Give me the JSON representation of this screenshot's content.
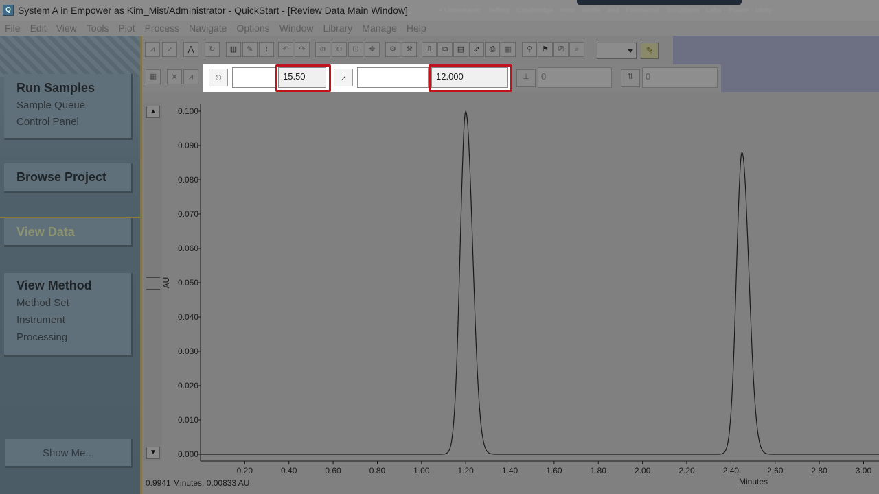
{
  "window": {
    "title": "System A in Empower as Kim_Mist/Administrator - QuickStart - [Review Data Main Window]",
    "title_blurred": "• Lineweaver · Jeffrey · Castleridge · Hele · Wolfe · and · Fleetwood · Scrubland · Labs · Power · Unity"
  },
  "menu": [
    "File",
    "Edit",
    "View",
    "Tools",
    "Plot",
    "Process",
    "Navigate",
    "Options",
    "Window",
    "Library",
    "Manage",
    "Help"
  ],
  "nav": {
    "run_samples": {
      "title": "Run Samples",
      "items": [
        "Sample Queue",
        "Control Panel"
      ]
    },
    "browse_project": {
      "title": "Browse Project"
    },
    "view_data": {
      "title": "View Data"
    },
    "view_method": {
      "title": "View Method",
      "items": [
        "Method Set",
        "Instrument",
        "Processing"
      ]
    },
    "show_me": "Show Me..."
  },
  "toolbar": {
    "field1_value": "",
    "field2_value": "15.50",
    "field3_value": "",
    "field4_value": "12.000",
    "field5_value": "0",
    "field6_value": "0",
    "dropdown_value": ""
  },
  "status": {
    "cursor_readout": "0.9941 Minutes, 0.00833 AU"
  },
  "colors": {
    "highlight_red": "#c0141f",
    "trace": "#1a1a1a",
    "plot_bg": "#808080"
  },
  "chart_data": {
    "type": "line",
    "xlabel": "Minutes",
    "ylabel": "AU",
    "xlim": [
      0.0,
      3.07
    ],
    "ylim": [
      -0.002,
      0.102
    ],
    "x_ticks": [
      "0.20",
      "0.40",
      "0.60",
      "0.80",
      "1.00",
      "1.20",
      "1.40",
      "1.60",
      "1.80",
      "2.00",
      "2.20",
      "2.40",
      "2.60",
      "2.80",
      "3.00"
    ],
    "y_ticks": [
      "0.000",
      "0.010",
      "0.020",
      "0.030",
      "0.040",
      "0.050",
      "0.060",
      "0.070",
      "0.080",
      "0.090",
      "0.100"
    ],
    "series": [
      {
        "peaks": [
          {
            "retention_time": 1.2,
            "height": 0.1
          },
          {
            "retention_time": 2.45,
            "height": 0.088
          }
        ],
        "baseline": 0.0
      }
    ]
  }
}
